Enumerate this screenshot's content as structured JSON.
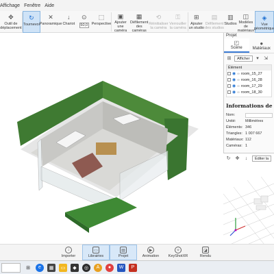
{
  "menu": [
    "Affichage",
    "Fenêtre",
    "Aide"
  ],
  "toolbar": {
    "items": [
      {
        "label": "Outil de\ndéplacement",
        "icon": "move-tool-icon"
      },
      {
        "label": "Tournevoi",
        "icon": "orbit-icon"
      },
      {
        "label": "Panoramique",
        "icon": "pan-icon"
      },
      {
        "label": "Chariot",
        "icon": "dolly-icon"
      },
      {
        "label": "50,0",
        "icon": "numeric-field"
      },
      {
        "label": "Perspective",
        "icon": "perspective-icon"
      },
      {
        "label": "Ajouter\nune caméra",
        "icon": "add-camera-icon"
      },
      {
        "label": "Défilement\ndes caméras",
        "icon": "cycle-cameras-icon"
      },
      {
        "label": "Réinitialiser\nla caméra",
        "icon": "reset-camera-icon"
      },
      {
        "label": "Verrouiller\nla caméra",
        "icon": "lock-camera-icon"
      },
      {
        "label": "Ajouter\nun studio",
        "icon": "add-studio-icon"
      },
      {
        "label": "Défilement\ndes studios",
        "icon": "cycle-studios-icon"
      },
      {
        "label": "Studios",
        "icon": "studios-icon"
      },
      {
        "label": "Modèles\nde matériaux",
        "icon": "material-models-icon"
      },
      {
        "label": "Vue\ngéométrique",
        "icon": "geometric-view-icon"
      }
    ]
  },
  "right_panel": {
    "title": "Projet",
    "tabs": [
      "Scène",
      "Matériaux"
    ],
    "afficher": "Afficher",
    "list_header": "Élément",
    "rows": [
      "room_15_27",
      "room_16_28",
      "room_17_29",
      "room_18_30"
    ],
    "info_title": "Informations de la scène",
    "info": [
      {
        "k": "Nom:",
        "v": ""
      },
      {
        "k": "Unité:",
        "v": "Millimètres"
      },
      {
        "k": "Éléments:",
        "v": "346"
      },
      {
        "k": "Triangles:",
        "v": "1 007 667"
      },
      {
        "k": "Matériaux:",
        "v": "112"
      },
      {
        "k": "Caméras:",
        "v": "1"
      }
    ],
    "mini_edit": "Éditer la"
  },
  "dock": [
    {
      "label": "Importer",
      "icon": "import-icon"
    },
    {
      "label": "Librairies",
      "icon": "library-icon"
    },
    {
      "label": "Projet",
      "icon": "project-icon"
    },
    {
      "label": "Animation",
      "icon": "animation-icon"
    },
    {
      "label": "KeyShotXR",
      "icon": "keyshotxr-icon"
    },
    {
      "label": "Rendu",
      "icon": "render-icon"
    }
  ]
}
